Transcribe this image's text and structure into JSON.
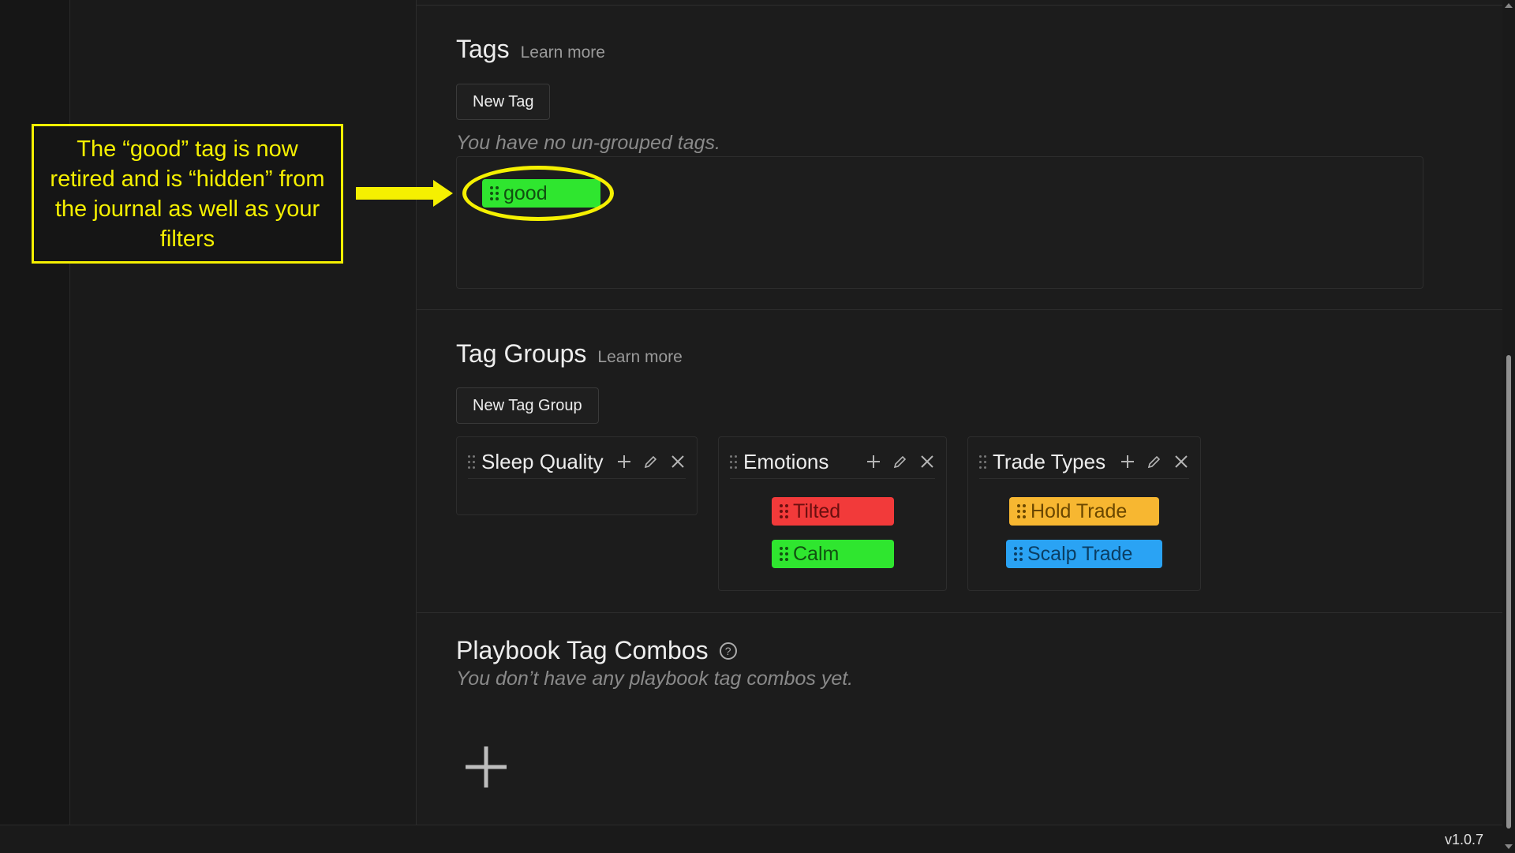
{
  "tags_section": {
    "title": "Tags",
    "learn_more": "Learn more",
    "new_tag_label": "New Tag",
    "empty_text": "You have no un-grouped tags.",
    "retired_tag": {
      "label": "good",
      "color": "#2fe62f"
    }
  },
  "tag_groups_section": {
    "title": "Tag Groups",
    "learn_more": "Learn more",
    "new_group_label": "New Tag Group",
    "groups": [
      {
        "name": "Sleep Quality",
        "tags": []
      },
      {
        "name": "Emotions",
        "tags": [
          {
            "label": "Tilted",
            "color": "#f23a3a"
          },
          {
            "label": "Calm",
            "color": "#2fe62f"
          }
        ]
      },
      {
        "name": "Trade Types",
        "tags": [
          {
            "label": "Hold Trade",
            "color": "#f7b731"
          },
          {
            "label": "Scalp Trade",
            "color": "#2aa3f4"
          }
        ]
      }
    ]
  },
  "playbook_section": {
    "title": "Playbook Tag Combos",
    "help_glyph": "?",
    "empty_text": "You don’t have any playbook tag combos yet."
  },
  "annotation": {
    "text": "The “good” tag is now retired and is “hidden” from the journal as well as your filters",
    "color": "#f5f001"
  },
  "footer": {
    "version": "v1.0.7"
  },
  "icons": {
    "add": "plus-icon",
    "edit": "pencil-icon",
    "delete": "close-icon",
    "drag": "drag-handle-icon",
    "help": "help-circle-icon",
    "add_combo": "plus-icon"
  }
}
